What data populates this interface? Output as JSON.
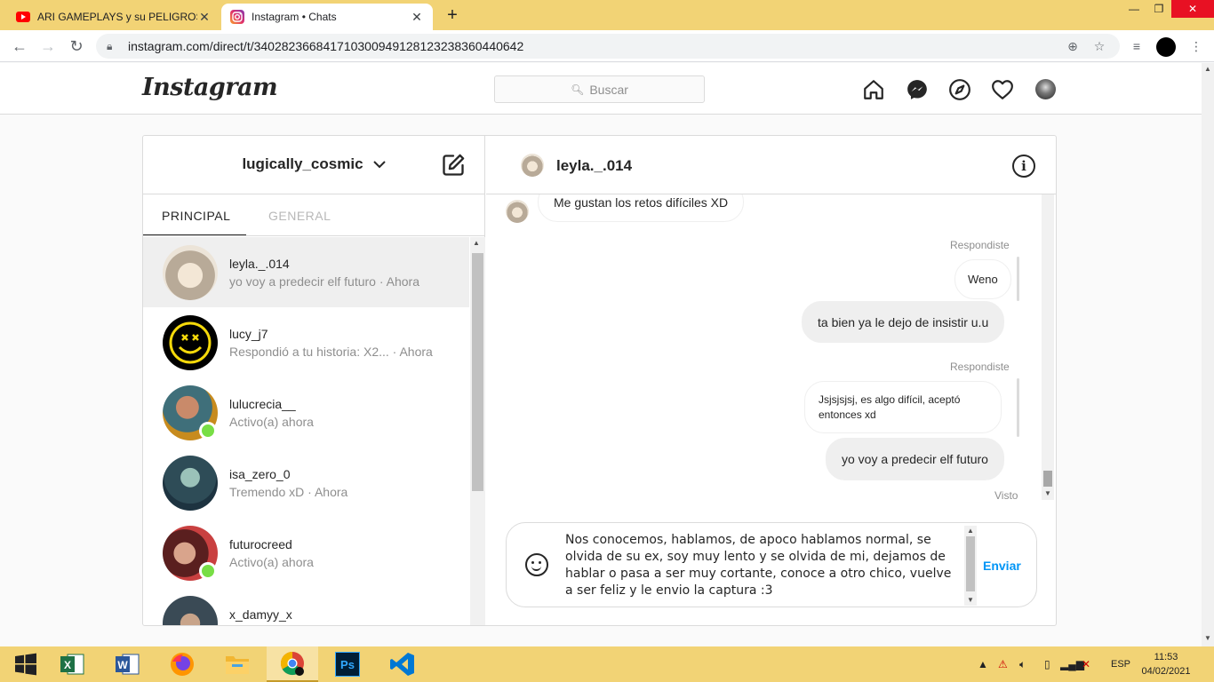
{
  "browser": {
    "tabs": [
      {
        "title": "ARI GAMEPLAYS y su PELIGROSA",
        "icon": "youtube-icon",
        "active": false
      },
      {
        "title": "Instagram • Chats",
        "icon": "instagram-icon",
        "active": true
      }
    ],
    "url": "instagram.com/direct/t/340282366841710300949128123238360440642"
  },
  "instagram": {
    "logo": "Instagram",
    "search_placeholder": "Buscar",
    "account_name": "lugically_cosmic",
    "tabs": {
      "principal": "PRINCIPAL",
      "general": "GENERAL"
    },
    "threads": [
      {
        "name": "leyla._.014",
        "preview": "yo voy a predecir elf futuro · Ahora",
        "selected": true,
        "online": false
      },
      {
        "name": "lucy_j7",
        "preview": "Respondió a tu historia: X2...  · Ahora",
        "selected": false,
        "online": false
      },
      {
        "name": "lulucrecia__",
        "preview": "Activo(a) ahora",
        "selected": false,
        "online": true
      },
      {
        "name": "isa_zero_0",
        "preview": "Tremendo xD · Ahora",
        "selected": false,
        "online": false
      },
      {
        "name": "futurocreed",
        "preview": "Activo(a) ahora",
        "selected": false,
        "online": true
      },
      {
        "name": "x_damyy_x",
        "preview": "",
        "selected": false,
        "online": false
      }
    ],
    "chat": {
      "contact": "leyla._.014",
      "messages": [
        {
          "text": "Me gustan los retos difíciles XD",
          "from": "them"
        },
        {
          "reply_label": "Respondiste",
          "quoted": "Weno",
          "text": "ta bien ya le dejo de insistir u.u",
          "from": "me"
        },
        {
          "reply_label": "Respondiste",
          "quoted": "Jsjsjsjsj, es algo difícil, aceptó entonces xd",
          "text": "yo voy a predecir elf futuro",
          "from": "me"
        }
      ],
      "seen": "Visto",
      "draft": "Nos conocemos, hablamos, de apoco hablamos normal, se olvida de su ex, soy muy lento y se olvida de mi, dejamos de hablar o pasa a ser muy cortante, conoce a otro chico, vuelve a ser feliz y le envio la captura :3",
      "send_label": "Enviar"
    }
  },
  "taskbar": {
    "apps": [
      "excel",
      "word",
      "firefox",
      "file-explorer",
      "chrome",
      "photoshop",
      "vscode"
    ],
    "language": "ESP",
    "time": "11:53",
    "date": "04/02/2021"
  }
}
